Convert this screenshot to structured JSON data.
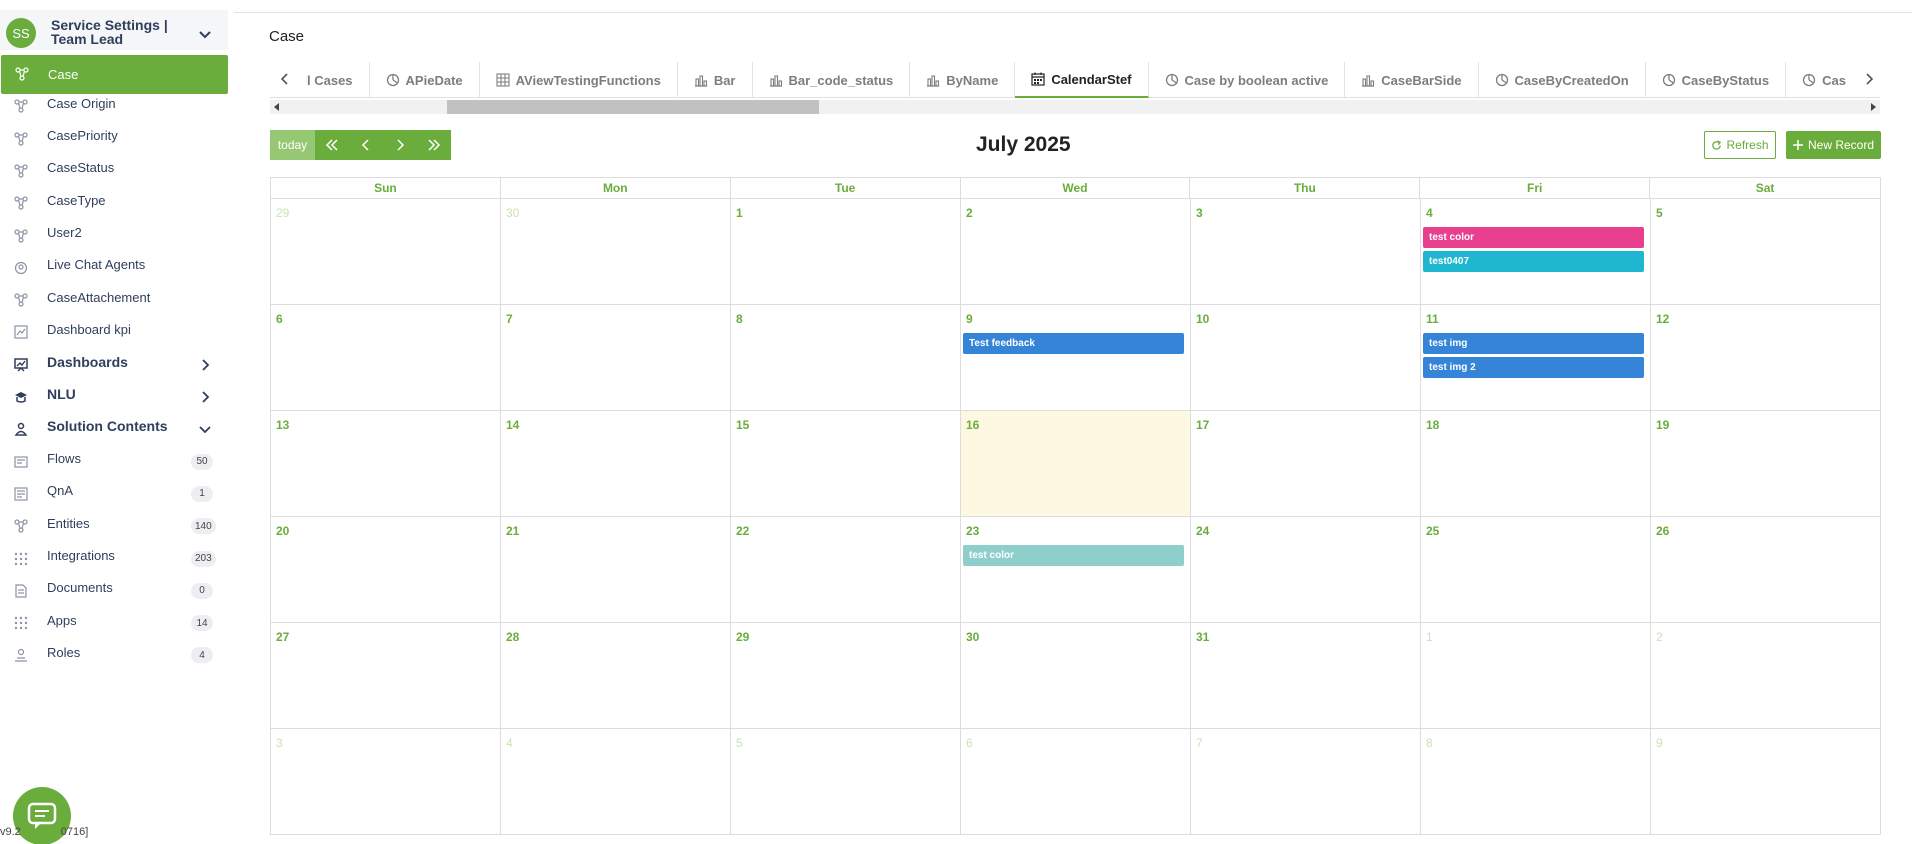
{
  "sidebar": {
    "avatar_initials": "SS",
    "title": "Service Settings | Team Lead",
    "items": [
      {
        "label": "Case",
        "icon": "entity-icon",
        "active": true
      },
      {
        "label": "Case Origin",
        "icon": "entity-icon"
      },
      {
        "label": "CasePriority",
        "icon": "entity-icon"
      },
      {
        "label": "CaseStatus",
        "icon": "entity-icon"
      },
      {
        "label": "CaseType",
        "icon": "entity-icon"
      },
      {
        "label": "User2",
        "icon": "entity-icon"
      },
      {
        "label": "Live Chat Agents",
        "icon": "agent-icon"
      },
      {
        "label": "CaseAttachement",
        "icon": "entity-icon"
      },
      {
        "label": "Dashboard kpi",
        "icon": "chart-icon"
      }
    ],
    "sections": [
      {
        "label": "Dashboards",
        "icon": "dashboard-icon",
        "expanded": false
      },
      {
        "label": "NLU",
        "icon": "nlu-icon",
        "expanded": false
      },
      {
        "label": "Solution Contents",
        "icon": "solution-icon",
        "expanded": true
      }
    ],
    "content_items": [
      {
        "label": "Flows",
        "count": "50",
        "icon": "flow-icon"
      },
      {
        "label": "QnA",
        "count": "1",
        "icon": "qna-icon"
      },
      {
        "label": "Entities",
        "count": "140",
        "icon": "entity-icon"
      },
      {
        "label": "Integrations",
        "count": "203",
        "icon": "grid-icon"
      },
      {
        "label": "Documents",
        "count": "0",
        "icon": "document-icon"
      },
      {
        "label": "Apps",
        "count": "14",
        "icon": "grid-icon"
      },
      {
        "label": "Roles",
        "count": "4",
        "icon": "role-icon"
      }
    ],
    "version": "v9.2",
    "version_suffix": "0716]"
  },
  "main": {
    "title": "Case",
    "tabs": [
      {
        "label": "All Cases",
        "icon": ""
      },
      {
        "label": "APieDate",
        "icon": "pie-icon"
      },
      {
        "label": "AViewTestingFunctions",
        "icon": "table-icon"
      },
      {
        "label": "Bar",
        "icon": "bar-icon"
      },
      {
        "label": "Bar_code_status",
        "icon": "bar-icon"
      },
      {
        "label": "ByName",
        "icon": "bar-icon"
      },
      {
        "label": "CalendarStef",
        "icon": "calendar-icon",
        "active": true
      },
      {
        "label": "Case by boolean active",
        "icon": "pie-icon"
      },
      {
        "label": "CaseBarSide",
        "icon": "bar-icon"
      },
      {
        "label": "CaseByCreatedOn",
        "icon": "pie-icon"
      },
      {
        "label": "CaseByStatus",
        "icon": "pie-icon"
      },
      {
        "label": "CaseBy",
        "icon": "pie-icon"
      }
    ]
  },
  "calendar": {
    "today_label": "today",
    "title": "July 2025",
    "refresh_label": "Refresh",
    "new_record_label": "New Record",
    "weekdays": [
      "Sun",
      "Mon",
      "Tue",
      "Wed",
      "Thu",
      "Fri",
      "Sat"
    ],
    "colors": {
      "accent": "#6aad3c",
      "today_bg": "#fdf8e1"
    },
    "weeks": [
      [
        {
          "d": "29",
          "other": true
        },
        {
          "d": "30",
          "other": true
        },
        {
          "d": "1"
        },
        {
          "d": "2"
        },
        {
          "d": "3"
        },
        {
          "d": "4",
          "events": [
            {
              "t": "test color",
              "c": "#e8408f"
            },
            {
              "t": "test0407",
              "c": "#1fb7cf"
            }
          ]
        },
        {
          "d": "5"
        }
      ],
      [
        {
          "d": "6"
        },
        {
          "d": "7"
        },
        {
          "d": "8"
        },
        {
          "d": "9",
          "events": [
            {
              "t": "Test feedback",
              "c": "#3584d8"
            }
          ]
        },
        {
          "d": "10"
        },
        {
          "d": "11",
          "events": [
            {
              "t": "test img",
              "c": "#3584d8"
            },
            {
              "t": "test img 2",
              "c": "#3584d8"
            }
          ]
        },
        {
          "d": "12"
        }
      ],
      [
        {
          "d": "13"
        },
        {
          "d": "14"
        },
        {
          "d": "15"
        },
        {
          "d": "16",
          "today": true
        },
        {
          "d": "17"
        },
        {
          "d": "18"
        },
        {
          "d": "19"
        }
      ],
      [
        {
          "d": "20"
        },
        {
          "d": "21"
        },
        {
          "d": "22"
        },
        {
          "d": "23",
          "events": [
            {
              "t": "test color",
              "c": "#8ecfcb"
            }
          ]
        },
        {
          "d": "24"
        },
        {
          "d": "25"
        },
        {
          "d": "26"
        }
      ],
      [
        {
          "d": "27"
        },
        {
          "d": "28"
        },
        {
          "d": "29"
        },
        {
          "d": "30"
        },
        {
          "d": "31"
        },
        {
          "d": "1",
          "other": true
        },
        {
          "d": "2",
          "other": true
        }
      ],
      [
        {
          "d": "3",
          "other": true
        },
        {
          "d": "4",
          "other": true
        },
        {
          "d": "5",
          "other": true
        },
        {
          "d": "6",
          "other": true
        },
        {
          "d": "7",
          "other": true
        },
        {
          "d": "8",
          "other": true
        },
        {
          "d": "9",
          "other": true
        }
      ]
    ]
  }
}
